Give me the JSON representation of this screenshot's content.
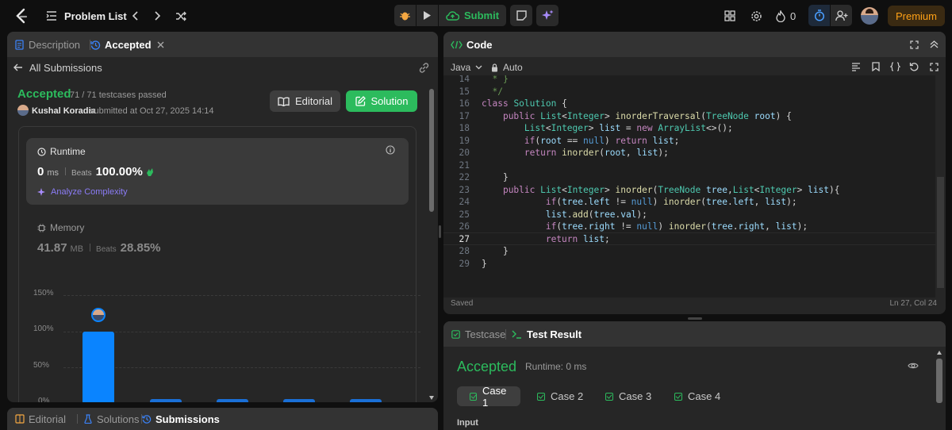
{
  "topbar": {
    "problem_list": "Problem List",
    "submit": "Submit",
    "streak": "0",
    "premium": "Premium"
  },
  "left": {
    "tabs": [
      {
        "label": "Description"
      },
      {
        "label": "Accepted"
      }
    ],
    "all_submissions": "All Submissions",
    "status": "Accepted",
    "testcases": "71 / 71 testcases passed",
    "user": "Kushal Koradia",
    "submitted_at": "submitted at Oct 27, 2025 14:14",
    "editorial_btn": "Editorial",
    "solution_btn": "Solution",
    "runtime": {
      "label": "Runtime",
      "value": "0",
      "unit": "ms",
      "beats_label": "Beats",
      "beats": "100.00%",
      "analyze": "Analyze Complexity"
    },
    "memory": {
      "label": "Memory",
      "value": "41.87",
      "unit": "MB",
      "beats_label": "Beats",
      "beats": "28.85%"
    },
    "bottom_tabs": [
      {
        "label": "Editorial"
      },
      {
        "label": "Solutions"
      },
      {
        "label": "Submissions"
      }
    ]
  },
  "chart_data": {
    "type": "bar",
    "y_ticks": [
      "150%",
      "100%",
      "50%",
      "0%"
    ],
    "ylim": [
      0,
      150
    ],
    "values": [
      100,
      6,
      6,
      6,
      6
    ],
    "highlight_index": 0
  },
  "code": {
    "title": "Code",
    "language": "Java",
    "mode": "Auto",
    "saved": "Saved",
    "cursor": "Ln 27, Col 24",
    "lines": [
      {
        "n": "14",
        "t": "  * }"
      },
      {
        "n": "15",
        "t": "  */"
      },
      {
        "n": "16",
        "t": "class Solution {"
      },
      {
        "n": "17",
        "t": "    public List<Integer> inorderTraversal(TreeNode root) {"
      },
      {
        "n": "18",
        "t": "        List<Integer> list = new ArrayList<>();"
      },
      {
        "n": "19",
        "t": "        if(root == null) return list;"
      },
      {
        "n": "20",
        "t": "        return inorder(root, list);"
      },
      {
        "n": "21",
        "t": ""
      },
      {
        "n": "22",
        "t": "    }"
      },
      {
        "n": "23",
        "t": "    public List<Integer> inorder(TreeNode tree,List<Integer> list){"
      },
      {
        "n": "24",
        "t": "            if(tree.left != null) inorder(tree.left, list);"
      },
      {
        "n": "25",
        "t": "            list.add(tree.val);"
      },
      {
        "n": "26",
        "t": "            if(tree.right != null) inorder(tree.right, list);"
      },
      {
        "n": "27",
        "t": "            return list;"
      },
      {
        "n": "28",
        "t": "    }"
      },
      {
        "n": "29",
        "t": "}"
      }
    ]
  },
  "result": {
    "tabs": [
      {
        "label": "Testcase"
      },
      {
        "label": "Test Result"
      }
    ],
    "status": "Accepted",
    "runtime": "Runtime: 0 ms",
    "cases": [
      "Case 1",
      "Case 2",
      "Case 3",
      "Case 4"
    ],
    "input_label": "Input"
  },
  "colors": {
    "accent_green": "#2cbb5d",
    "accent_blue": "#0a84ff",
    "premium": "#ffa116"
  }
}
